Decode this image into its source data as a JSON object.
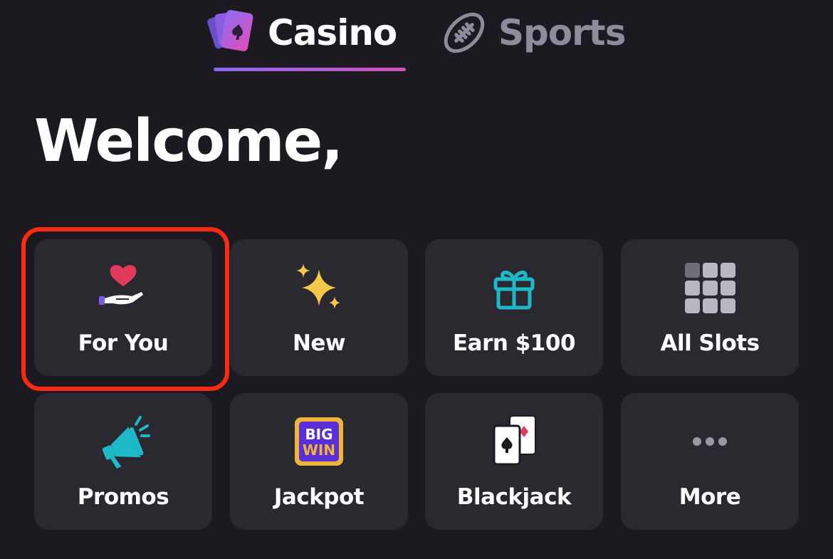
{
  "tabs": [
    {
      "label": "Casino",
      "icon": "playing-cards-icon",
      "active": true
    },
    {
      "label": "Sports",
      "icon": "football-icon",
      "active": false
    }
  ],
  "welcome": {
    "text": "Welcome,"
  },
  "categories": [
    {
      "label": "For You",
      "icon": "heart-hand-icon",
      "highlighted": true
    },
    {
      "label": "New",
      "icon": "sparkles-icon"
    },
    {
      "label": "Earn $100",
      "icon": "gift-icon"
    },
    {
      "label": "All Slots",
      "icon": "grid-icon"
    },
    {
      "label": "Promos",
      "icon": "megaphone-icon"
    },
    {
      "label": "Jackpot",
      "icon": "big-win-icon",
      "icon_text": [
        "BIG",
        "WIN"
      ]
    },
    {
      "label": "Blackjack",
      "icon": "cards-icon"
    },
    {
      "label": "More",
      "icon": "ellipsis-icon"
    }
  ],
  "colors": {
    "background": "#1c1a20",
    "tile": "#2a292f",
    "accent_gradient": [
      "#8c6af0",
      "#d54fbd"
    ],
    "highlight": "#ff2a11",
    "inactive_text": "#8e8b9a"
  }
}
